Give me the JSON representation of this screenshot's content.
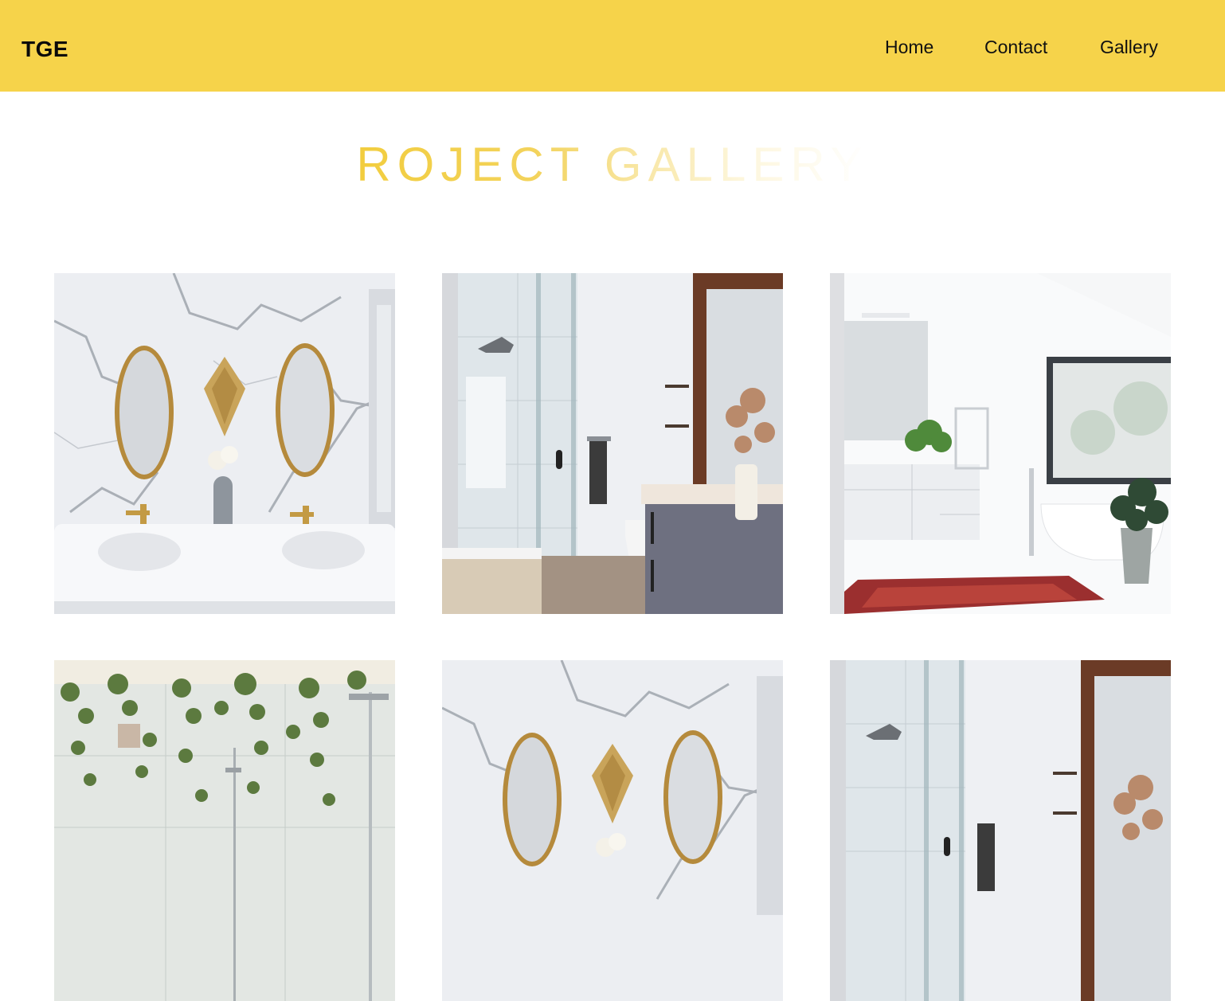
{
  "nav": {
    "logo": "TGE",
    "links": [
      {
        "label": "Home"
      },
      {
        "label": "Contact"
      },
      {
        "label": "Gallery"
      }
    ],
    "background": "#f6d34a"
  },
  "gallery": {
    "title": "ROJECT GALLERY",
    "accent": "#f2cd3e",
    "items": [
      {
        "scene": "marble-double-vanity"
      },
      {
        "scene": "glass-shower-wood-mirror"
      },
      {
        "scene": "white-bathroom-tub-rug"
      },
      {
        "scene": "shower-hanging-plants"
      },
      {
        "scene": "marble-double-vanity"
      },
      {
        "scene": "glass-shower-wood-mirror"
      }
    ]
  }
}
